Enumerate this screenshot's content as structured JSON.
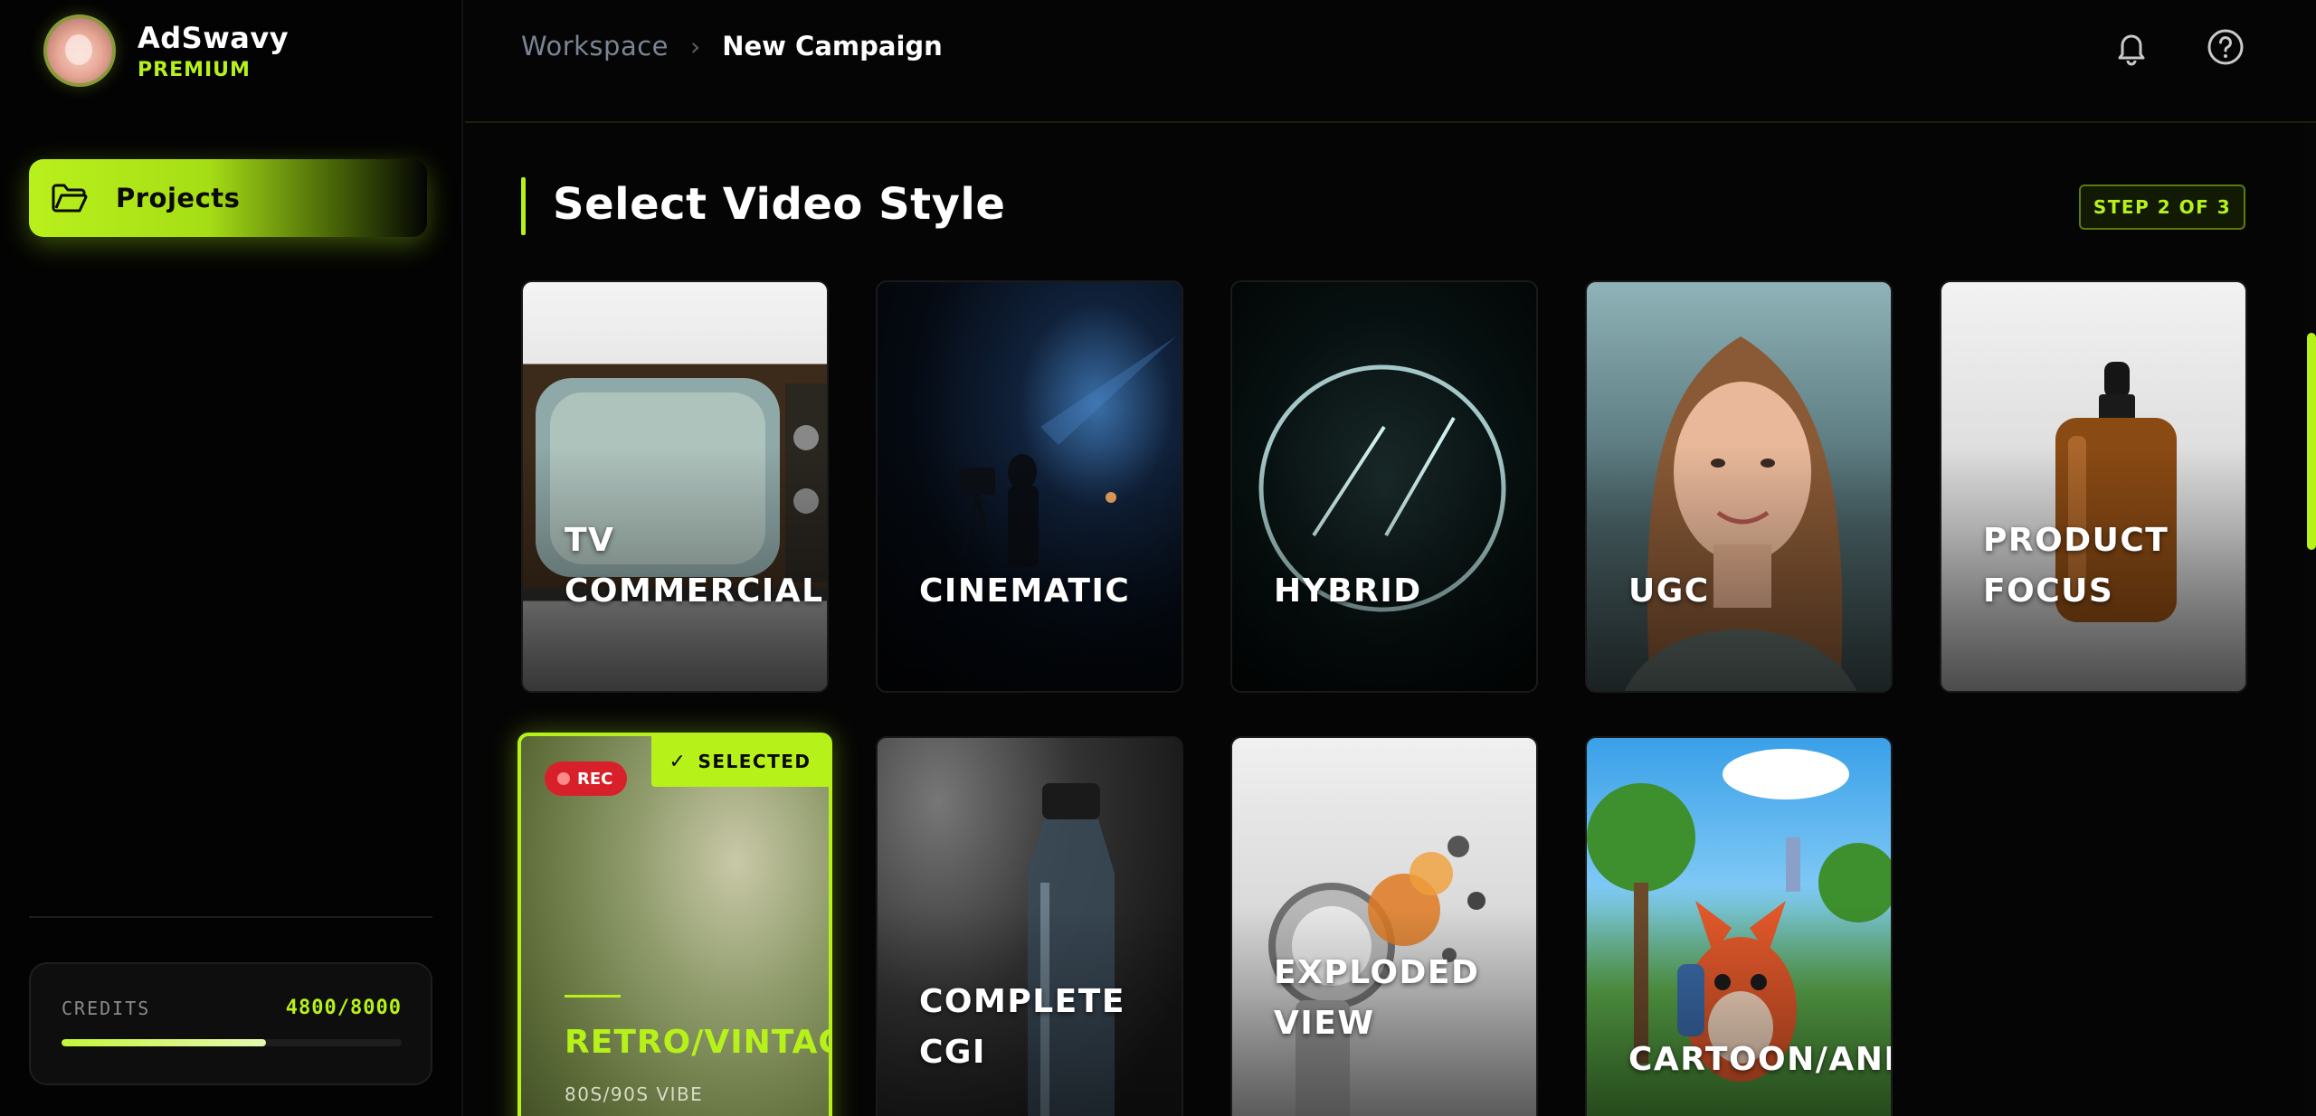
{
  "brand": {
    "name": "AdSwavy",
    "tier": "PREMIUM"
  },
  "nav": {
    "projects_label": "Projects"
  },
  "credits": {
    "label": "CREDITS",
    "value": "4800/8000",
    "progress_fraction": 0.6
  },
  "breadcrumb": {
    "workspace": "Workspace",
    "separator": "›",
    "current": "New Campaign"
  },
  "header_icons": [
    "bell-icon",
    "help-icon"
  ],
  "page": {
    "title": "Select Video Style",
    "step": "STEP 2 OF 3"
  },
  "styles": [
    {
      "label_lines": [
        "TV",
        "COMMERCIAL"
      ]
    },
    {
      "label_lines": [
        "CINEMATIC"
      ]
    },
    {
      "label_lines": [
        "HYBRID"
      ]
    },
    {
      "label_lines": [
        "UGC"
      ]
    },
    {
      "label_lines": [
        "PRODUCT",
        "FOCUS"
      ]
    },
    {
      "label_lines": [
        "RETRO/VINTAGE"
      ],
      "subtitle": "80S/90S VIBE",
      "badge": "REC",
      "selected_label": "SELECTED"
    },
    {
      "label_lines": [
        "COMPLETE",
        "CGI"
      ]
    },
    {
      "label_lines": [
        "EXPLODED",
        "VIEW"
      ]
    },
    {
      "label_lines": [
        "CARTOON/ANIMA"
      ]
    }
  ],
  "colors": {
    "accent": "#b6f21a",
    "background": "#050505",
    "rec_badge": "#d8202a"
  }
}
